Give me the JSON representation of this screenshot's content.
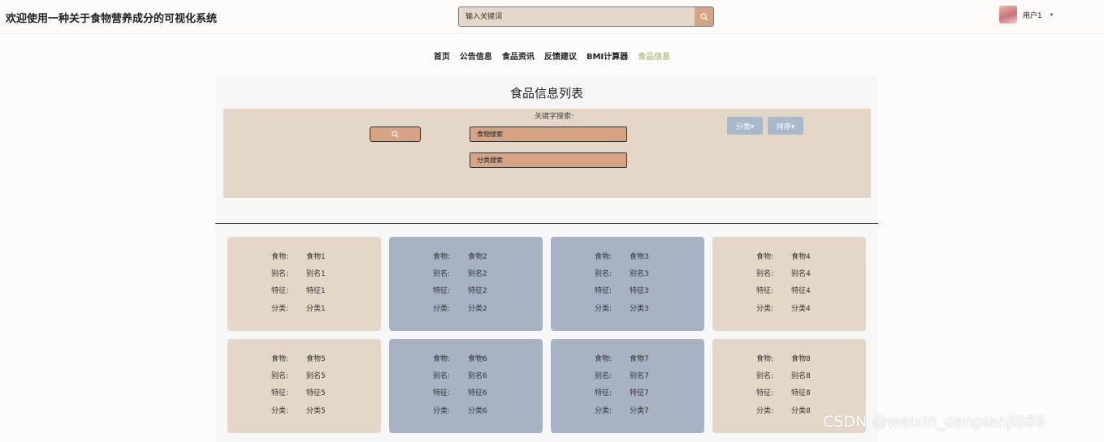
{
  "header": {
    "title": "欢迎使用一种关于食物营养成分的可视化系统",
    "search_placeholder": "输入关键词",
    "user_name": "用户1",
    "caret": "▾"
  },
  "nav": {
    "items": [
      "首页",
      "公告信息",
      "食品资讯",
      "反馈建议",
      "BMI计算器",
      "食品信息"
    ],
    "active_index": 5,
    "active_color": "#b9c98a"
  },
  "panel": {
    "title": "食品信息列表",
    "keyword_label": "关键字搜索:",
    "food_search_placeholder": "食物搜索",
    "category_search_placeholder": "分类搜索",
    "category_dropdown": "分类▾",
    "sort_dropdown": "排序▾"
  },
  "labels": {
    "food": "食物:",
    "alias": "别名:",
    "feature": "特征:",
    "category": "分类:"
  },
  "cards": [
    {
      "food": "食物1",
      "alias": "别名1",
      "feature": "特征1",
      "category": "分类1",
      "style": "tan"
    },
    {
      "food": "食物2",
      "alias": "别名2",
      "feature": "特征2",
      "category": "分类2",
      "style": "blue"
    },
    {
      "food": "食物3",
      "alias": "别名3",
      "feature": "特征3",
      "category": "分类3",
      "style": "blue"
    },
    {
      "food": "食物4",
      "alias": "别名4",
      "feature": "特征4",
      "category": "分类4",
      "style": "tan"
    },
    {
      "food": "食物5",
      "alias": "别名5",
      "feature": "特征5",
      "category": "分类5",
      "style": "tan"
    },
    {
      "food": "食物6",
      "alias": "别名6",
      "feature": "特征6",
      "category": "分类6",
      "style": "blue"
    },
    {
      "food": "食物7",
      "alias": "别名7",
      "feature": "特征7",
      "category": "分类7",
      "style": "blue"
    },
    {
      "food": "食物8",
      "alias": "别名8",
      "feature": "特征8",
      "category": "分类8",
      "style": "tan"
    }
  ],
  "watermark": "CSDN @weixin_danpianji889",
  "colors": {
    "accent": "#d8a383",
    "tan": "#e4d7c7",
    "blue": "#a7b2c3"
  }
}
